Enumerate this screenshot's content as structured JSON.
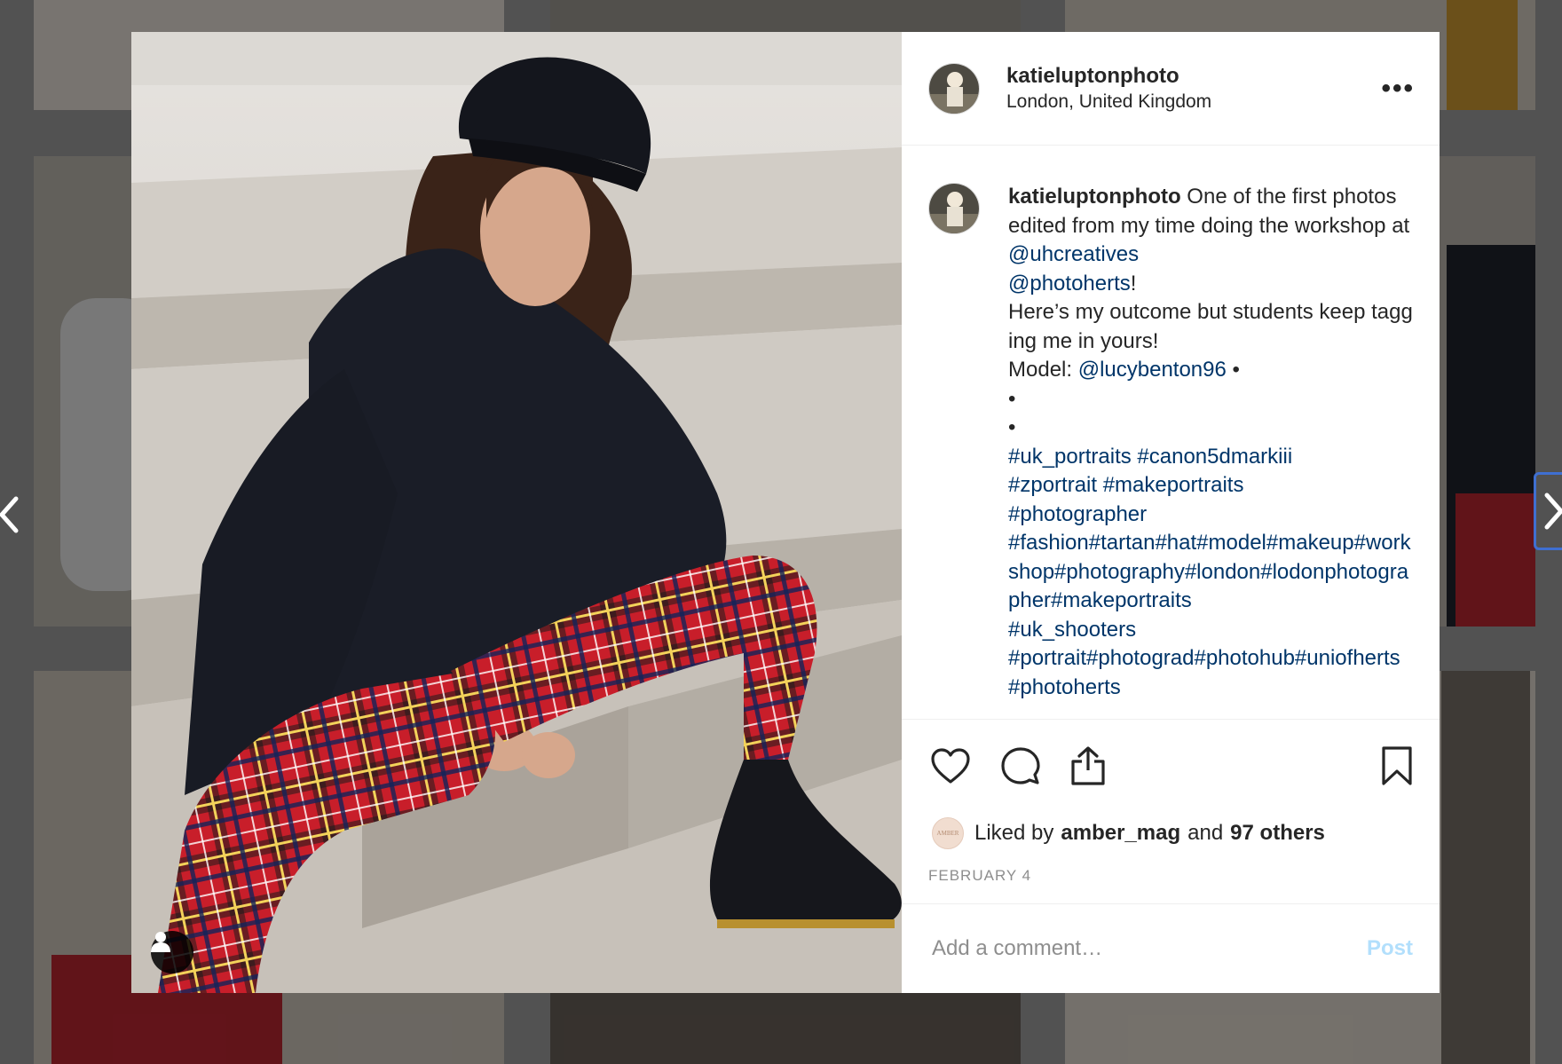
{
  "post": {
    "username": "katieluptonphoto",
    "location": "London, United Kingdom",
    "more_label": "•••",
    "caption": {
      "username": "katieluptonphoto",
      "line1_text": " One of the first photos edited from my time doing the workshop at ",
      "mention1": "@uhcreatives",
      "mention2": "@photoherts",
      "after_mention2": "!",
      "line2": "Here’s my outcome but students keep tagging me in yours!",
      "model_label": "Model: ",
      "model_mention": "@lucybenton96",
      "model_suffix": " •",
      "bullet1": "•",
      "bullet2": "•",
      "hashtags_1": "#uk_portraits #canon5dmarkiii",
      "hashtags_2": "#zportrait #makeportraits",
      "hashtags_3": "#photographer",
      "hashtags_4": "#fashion#tartan#hat#model#makeup#workshop#photography#london#lodonphotographer#makeportraits",
      "hashtags_5": "#uk_shooters",
      "hashtags_6": "#portrait#photograd#photohub#uniofherts #photoherts"
    },
    "likes": {
      "avatar_text": "AMBER",
      "prefix": "Liked by ",
      "user": "amber_mag",
      "middle": " and ",
      "others": "97 others"
    },
    "date": "FEBRUARY 4",
    "comment": {
      "placeholder": "Add a comment…",
      "post_label": "Post"
    }
  },
  "icons": {
    "like": "heart-icon",
    "comment": "comment-icon",
    "share": "share-icon",
    "save": "bookmark-icon",
    "tag": "user-tag-icon",
    "prev": "chevron-left-icon",
    "next": "chevron-right-icon"
  },
  "colors": {
    "link": "#003569",
    "post_button_disabled": "#b2dffc",
    "muted": "#8e8e8e"
  }
}
